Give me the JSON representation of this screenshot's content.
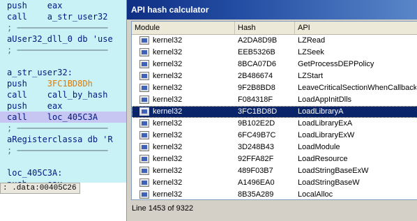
{
  "disasm": {
    "lines": [
      {
        "text": "push    eax"
      },
      {
        "text": "call    a_str_user32"
      },
      {
        "text": "; ──────────────────"
      },
      {
        "text": "aUser32_dll_0 db 'use"
      },
      {
        "text": "; ──────────────────"
      },
      {
        "text": ""
      },
      {
        "text": "a_str_user32:"
      },
      {
        "pre": "push    ",
        "orange": "3FC1BD8Dh"
      },
      {
        "text": "call    call_by_hash"
      },
      {
        "text": "push    eax"
      },
      {
        "text": "call    loc_405C3A"
      },
      {
        "text": "; ──────────────────"
      },
      {
        "text": "aRegisterclassa db 'R"
      },
      {
        "text": "; ──────────────────"
      },
      {
        "text": ""
      },
      {
        "text": "loc_405C3A:"
      },
      {
        "text": "push    eax"
      }
    ],
    "status": ": .data:00405C26"
  },
  "window": {
    "title": "API hash calculator",
    "columns": [
      "Module",
      "Hash",
      "API"
    ],
    "rows": [
      {
        "module": "kernel32",
        "hash": "A2DA8D9B",
        "api": "LZRead"
      },
      {
        "module": "kernel32",
        "hash": "EEB5326B",
        "api": "LZSeek"
      },
      {
        "module": "kernel32",
        "hash": "8BCA07D6",
        "api": "GetProcessDEPPolicy"
      },
      {
        "module": "kernel32",
        "hash": "2B486674",
        "api": "LZStart"
      },
      {
        "module": "kernel32",
        "hash": "9F2B8BD8",
        "api": "LeaveCriticalSectionWhenCallbackRe"
      },
      {
        "module": "kernel32",
        "hash": "F084318F",
        "api": "LoadAppInitDlls"
      },
      {
        "module": "kernel32",
        "hash": "3FC1BD8D",
        "api": "LoadLibraryA"
      },
      {
        "module": "kernel32",
        "hash": "9B102E2D",
        "api": "LoadLibraryExA"
      },
      {
        "module": "kernel32",
        "hash": "6FC49B7C",
        "api": "LoadLibraryExW"
      },
      {
        "module": "kernel32",
        "hash": "3D248B43",
        "api": "LoadModule"
      },
      {
        "module": "kernel32",
        "hash": "92FFA82F",
        "api": "LoadResource"
      },
      {
        "module": "kernel32",
        "hash": "489F03B7",
        "api": "LoadStringBaseExW"
      },
      {
        "module": "kernel32",
        "hash": "A1496EA0",
        "api": "LoadStringBaseW"
      },
      {
        "module": "kernel32",
        "hash": "8B35A289",
        "api": "LocalAlloc"
      }
    ],
    "selected_row": 6,
    "footer": "Line 1453 of 9322"
  }
}
